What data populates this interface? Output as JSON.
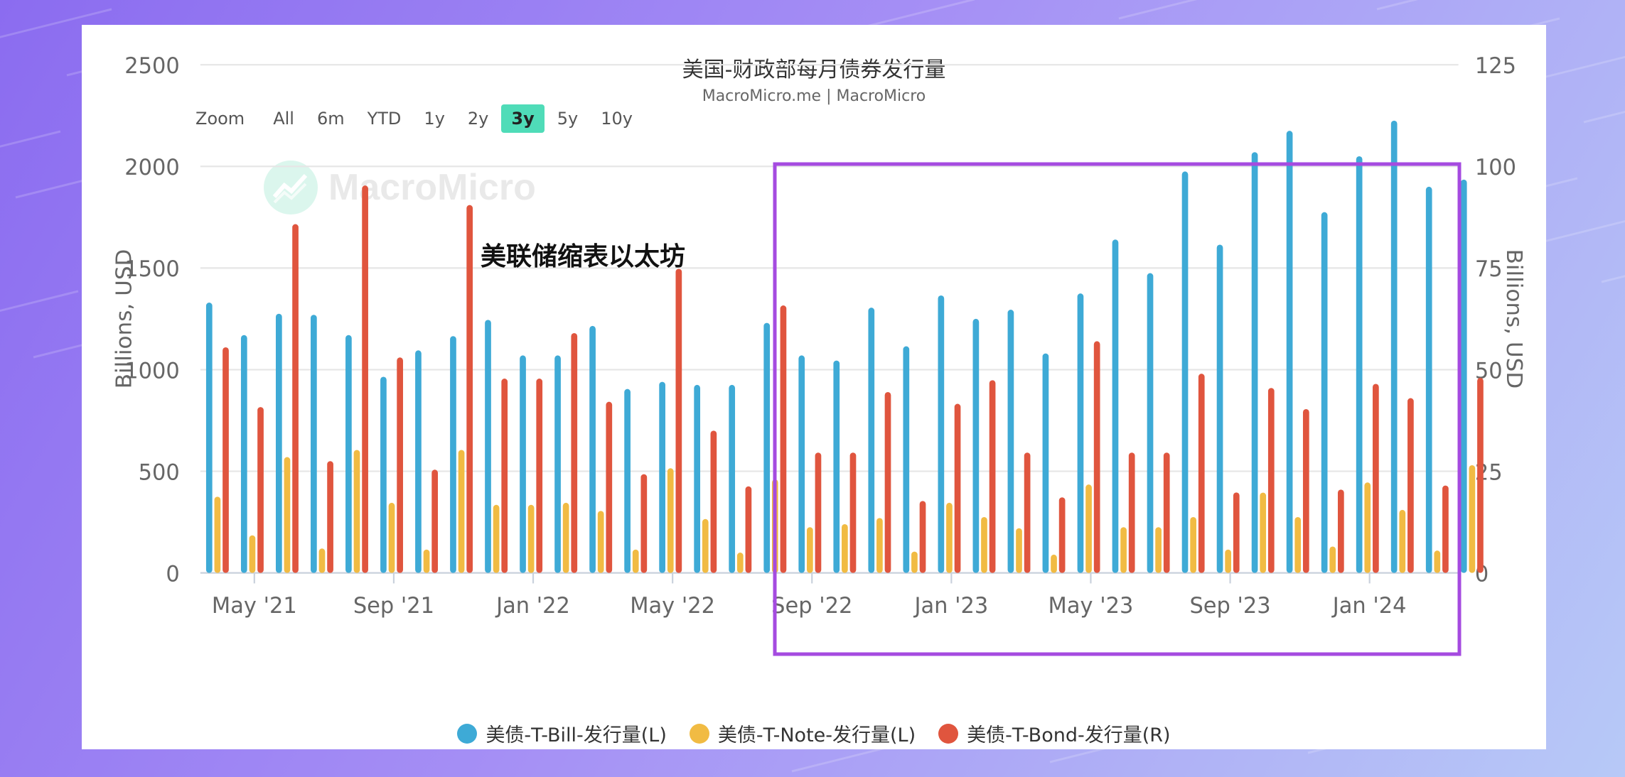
{
  "chart_data": {
    "type": "bar",
    "title": "美国-财政部每月债券发行量",
    "subtitle": "MacroMicro.me | MacroMicro",
    "y_left_label": "Billions, USD",
    "y_right_label": "Billions, USD",
    "y_left_ticks": [
      "0",
      "500",
      "1000",
      "1500",
      "2000",
      "2500"
    ],
    "y_right_ticks": [
      "0",
      "25",
      "50",
      "75",
      "100",
      "125"
    ],
    "ylim_left": [
      0,
      2500
    ],
    "ylim_right": [
      0,
      125
    ],
    "x_ticks": [
      "May '21",
      "Sep '21",
      "Jan '22",
      "May '22",
      "Sep '22",
      "Jan '23",
      "May '23",
      "Sep '23",
      "Jan '24"
    ],
    "x_tick_month_index": [
      1,
      5,
      9,
      13,
      17,
      21,
      25,
      29,
      33
    ],
    "months": [
      "2021-04",
      "2021-05",
      "2021-06",
      "2021-07",
      "2021-08",
      "2021-09",
      "2021-10",
      "2021-11",
      "2021-12",
      "2022-01",
      "2022-02",
      "2022-03",
      "2022-04",
      "2022-05",
      "2022-06",
      "2022-07",
      "2022-08",
      "2022-09",
      "2022-10",
      "2022-11",
      "2022-12",
      "2023-01",
      "2023-02",
      "2023-03",
      "2023-04",
      "2023-05",
      "2023-06",
      "2023-07",
      "2023-08",
      "2023-09",
      "2023-10",
      "2023-11",
      "2023-12",
      "2024-01",
      "2024-02",
      "2024-03"
    ],
    "series": [
      {
        "name": "美债-T-Bill-发行量(L)",
        "axis": "left",
        "color": "#3eaad6",
        "values": [
          1330,
          1170,
          1275,
          1270,
          1170,
          965,
          1095,
          1165,
          1245,
          1070,
          1070,
          1215,
          905,
          940,
          925,
          925,
          1230,
          1070,
          1045,
          1305,
          1115,
          1365,
          1250,
          1295,
          1080,
          1375,
          1640,
          1475,
          1975,
          1615,
          2070,
          2175,
          1775,
          2050,
          2225,
          1900,
          1935
        ]
      },
      {
        "name": "美债-T-Note-发行量(L)",
        "axis": "left",
        "color": "#f1bb43",
        "values": [
          375,
          185,
          570,
          120,
          605,
          345,
          115,
          605,
          335,
          335,
          345,
          305,
          115,
          515,
          265,
          100,
          460,
          225,
          240,
          270,
          105,
          345,
          275,
          220,
          90,
          435,
          225,
          225,
          275,
          115,
          395,
          275,
          130,
          445,
          310,
          110,
          530
        ]
      },
      {
        "name": "美债-T-Bond-发行量(R)",
        "axis": "right",
        "color": "#e0553e",
        "values": [
          55.5,
          40.8,
          85.8,
          27.5,
          95.3,
          53,
          25.4,
          90.5,
          47.8,
          47.8,
          59,
          42.1,
          24.3,
          74.8,
          35,
          21.3,
          65.8,
          29.6,
          29.6,
          44.5,
          17.7,
          41.6,
          47.4,
          29.6,
          18.6,
          57,
          29.6,
          29.6,
          49,
          19.8,
          45.5,
          40.3,
          20.5,
          46.5,
          43,
          21.5,
          48
        ]
      }
    ],
    "legend_position": "bottom-center",
    "grid": true
  },
  "ui": {
    "zoom_label": "Zoom",
    "zoom_buttons": [
      "All",
      "6m",
      "YTD",
      "1y",
      "2y",
      "3y",
      "5y",
      "10y"
    ],
    "zoom_active": "3y",
    "watermark": "MacroMicro",
    "overlay_text": "美联储缩表以太坊"
  }
}
